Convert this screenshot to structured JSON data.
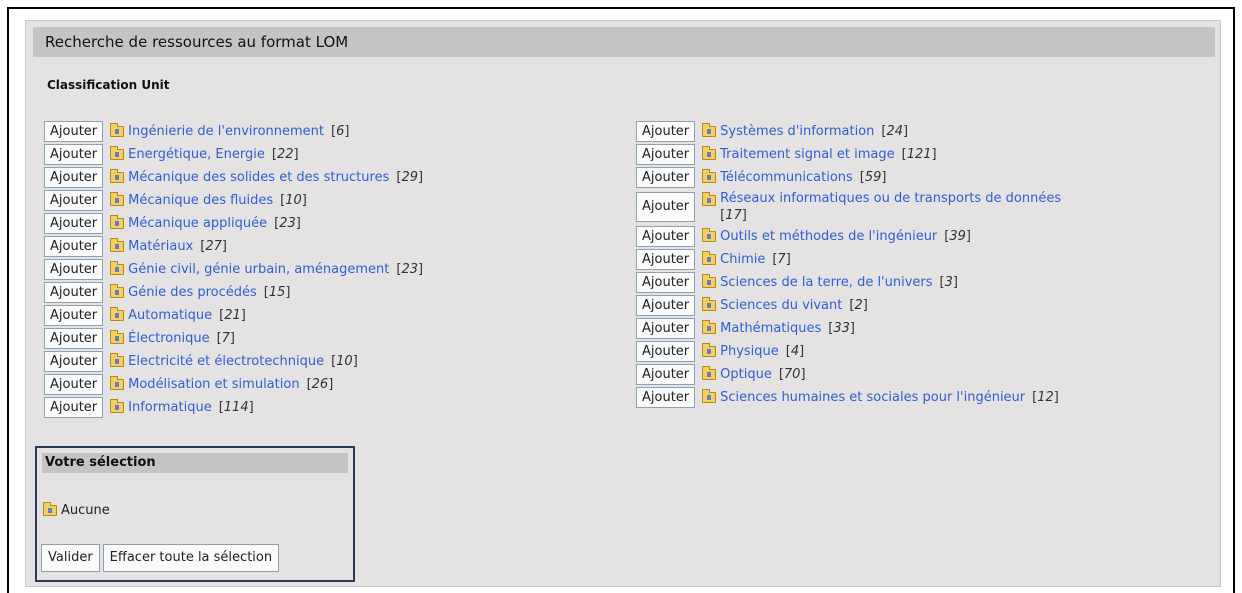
{
  "panel": {
    "title": "Recherche de ressources au format LOM",
    "subtitle": "Classification Unit"
  },
  "add_label": "Ajouter",
  "left_items": [
    {
      "label": "Ingénierie de l'environnement",
      "count": "6"
    },
    {
      "label": "Energétique, Energie",
      "count": "22"
    },
    {
      "label": "Mécanique des solides et des structures",
      "count": "29"
    },
    {
      "label": "Mécanique des fluides",
      "count": "10"
    },
    {
      "label": "Mécanique appliquée",
      "count": "23"
    },
    {
      "label": "Matériaux",
      "count": "27"
    },
    {
      "label": "Génie civil, génie urbain, aménagement",
      "count": "23"
    },
    {
      "label": "Génie des procédés",
      "count": "15"
    },
    {
      "label": "Automatique",
      "count": "21"
    },
    {
      "label": "Électronique",
      "count": "7"
    },
    {
      "label": "Electricité et électrotechnique",
      "count": "10"
    },
    {
      "label": "Modélisation et simulation",
      "count": "26"
    },
    {
      "label": "Informatique",
      "count": "114"
    }
  ],
  "right_items": [
    {
      "label": "Systèmes d'information",
      "count": "24"
    },
    {
      "label": "Traitement signal et image",
      "count": "121"
    },
    {
      "label": "Télécommunications",
      "count": "59"
    },
    {
      "label": "Réseaux informatiques ou de transports de données",
      "count": "17"
    },
    {
      "label": "Outils et méthodes de l'ingénieur",
      "count": "39"
    },
    {
      "label": "Chimie",
      "count": "7"
    },
    {
      "label": "Sciences de la terre, de l'univers",
      "count": "3"
    },
    {
      "label": "Sciences du vivant",
      "count": "2"
    },
    {
      "label": "Mathématiques",
      "count": "33"
    },
    {
      "label": "Physique",
      "count": "4"
    },
    {
      "label": "Optique",
      "count": "70"
    },
    {
      "label": "Sciences humaines et sociales pour l'ingénieur",
      "count": "12"
    }
  ],
  "selection": {
    "title": "Votre sélection",
    "empty_label": "Aucune",
    "validate_label": "Valider",
    "clear_label": "Effacer toute la sélection"
  },
  "icons": {
    "category": "folder-icon"
  },
  "colors": {
    "link": "#2f5fd0",
    "panel_bg": "#e4e2e2",
    "title_bar": "#c5c3c3"
  }
}
